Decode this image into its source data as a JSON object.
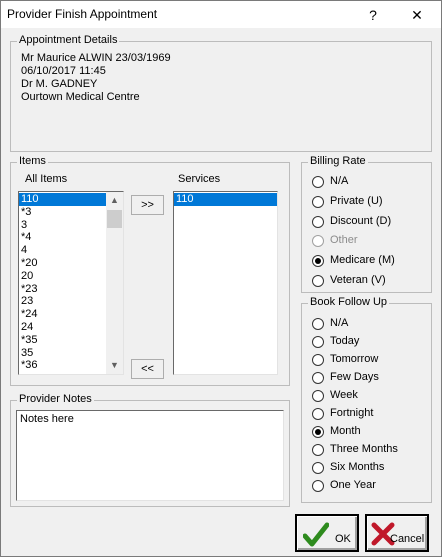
{
  "window": {
    "title": "Provider Finish Appointment",
    "help_label": "?",
    "close_label": "✕"
  },
  "appointment": {
    "group_label": "Appointment Details",
    "patient": "Mr Maurice ALWIN 23/03/1969",
    "datetime": "06/10/2017 11:45",
    "doctor": "Dr M. GADNEY",
    "location": "Ourtown Medical Centre"
  },
  "items": {
    "group_label": "Items",
    "all_items_label": "All Items",
    "services_label": "Services",
    "all_items": [
      "110",
      "*3",
      "3",
      "*4",
      "4",
      "*20",
      "20",
      "*23",
      "23",
      "*24",
      "24",
      "*35",
      "35",
      "*36"
    ],
    "selected_all_item": "110",
    "services": [
      "110"
    ],
    "add_label": ">>",
    "remove_label": "<<"
  },
  "notes": {
    "group_label": "Provider Notes",
    "value": "Notes here"
  },
  "billing": {
    "group_label": "Billing Rate",
    "options": [
      {
        "label": "N/A",
        "checked": false,
        "disabled": false
      },
      {
        "label": "Private (U)",
        "checked": false,
        "disabled": false
      },
      {
        "label": "Discount (D)",
        "checked": false,
        "disabled": false
      },
      {
        "label": "Other",
        "checked": false,
        "disabled": true
      },
      {
        "label": "Medicare (M)",
        "checked": true,
        "disabled": false
      },
      {
        "label": "Veteran  (V)",
        "checked": false,
        "disabled": false
      }
    ]
  },
  "followup": {
    "group_label": "Book Follow Up",
    "options": [
      {
        "label": "N/A",
        "checked": false
      },
      {
        "label": "Today",
        "checked": false
      },
      {
        "label": "Tomorrow",
        "checked": false
      },
      {
        "label": "Few Days",
        "checked": false
      },
      {
        "label": "Week",
        "checked": false
      },
      {
        "label": "Fortnight",
        "checked": false
      },
      {
        "label": "Month",
        "checked": true
      },
      {
        "label": "Three Months",
        "checked": false
      },
      {
        "label": "Six Months",
        "checked": false
      },
      {
        "label": "One Year",
        "checked": false
      }
    ]
  },
  "buttons": {
    "ok_label": "OK",
    "cancel_label": "Cancel"
  },
  "colors": {
    "selection": "#0078d7",
    "ok_check": "#2e8b1e",
    "cancel_x": "#c0182a"
  }
}
